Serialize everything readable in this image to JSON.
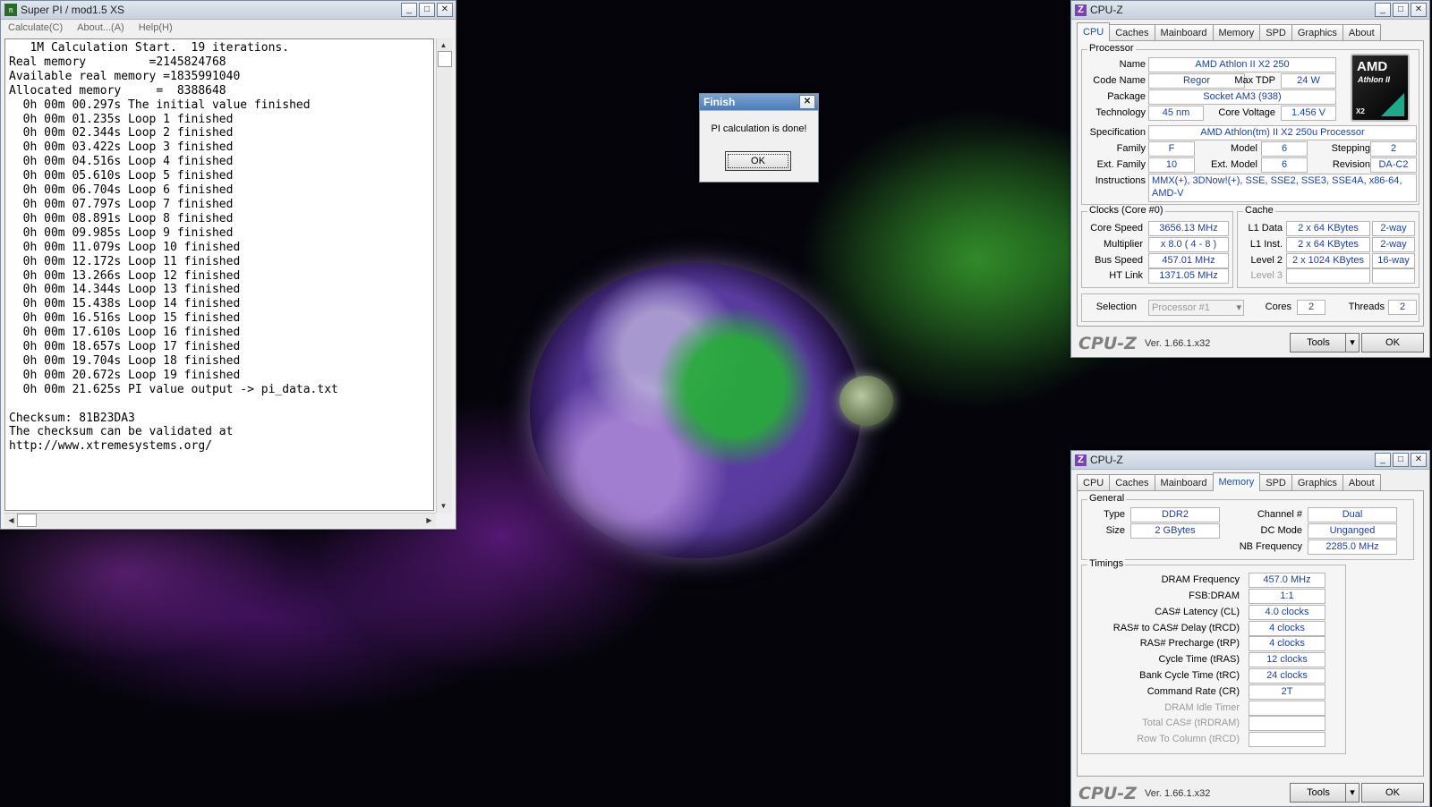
{
  "superpi": {
    "title": "Super PI / mod1.5 XS",
    "menu": [
      "Calculate(C)",
      "About...(A)",
      "Help(H)"
    ],
    "lines": [
      "   1M Calculation Start.  19 iterations.",
      "Real memory         =2145824768",
      "Available real memory =1835991040",
      "Allocated memory     =  8388648",
      "  0h 00m 00.297s The initial value finished",
      "  0h 00m 01.235s Loop 1 finished",
      "  0h 00m 02.344s Loop 2 finished",
      "  0h 00m 03.422s Loop 3 finished",
      "  0h 00m 04.516s Loop 4 finished",
      "  0h 00m 05.610s Loop 5 finished",
      "  0h 00m 06.704s Loop 6 finished",
      "  0h 00m 07.797s Loop 7 finished",
      "  0h 00m 08.891s Loop 8 finished",
      "  0h 00m 09.985s Loop 9 finished",
      "  0h 00m 11.079s Loop 10 finished",
      "  0h 00m 12.172s Loop 11 finished",
      "  0h 00m 13.266s Loop 12 finished",
      "  0h 00m 14.344s Loop 13 finished",
      "  0h 00m 15.438s Loop 14 finished",
      "  0h 00m 16.516s Loop 15 finished",
      "  0h 00m 17.610s Loop 16 finished",
      "  0h 00m 18.657s Loop 17 finished",
      "  0h 00m 19.704s Loop 18 finished",
      "  0h 00m 20.672s Loop 19 finished",
      "  0h 00m 21.625s PI value output -> pi_data.txt",
      "",
      "Checksum: 81B23DA3",
      "The checksum can be validated at",
      "http://www.xtremesystems.org/"
    ]
  },
  "finish_dialog": {
    "title": "Finish",
    "message": "PI calculation is done!",
    "ok": "OK"
  },
  "cpuz_common": {
    "title": "CPU-Z",
    "tabs": [
      "CPU",
      "Caches",
      "Mainboard",
      "Memory",
      "SPD",
      "Graphics",
      "About"
    ],
    "brand": "CPU-Z",
    "version": "Ver. 1.66.1.x32",
    "tools": "Tools",
    "ok": "OK"
  },
  "cpu": {
    "group_processor": "Processor",
    "name_label": "Name",
    "name": "AMD Athlon II X2 250",
    "codename_label": "Code Name",
    "codename": "Regor",
    "maxtdp_label": "Max TDP",
    "maxtdp": "24 W",
    "package_label": "Package",
    "package": "Socket AM3 (938)",
    "tech_label": "Technology",
    "tech": "45 nm",
    "voltage_label": "Core Voltage",
    "voltage": "1.456 V",
    "spec_label": "Specification",
    "spec": "AMD Athlon(tm) II X2 250u Processor",
    "family_label": "Family",
    "family": "F",
    "model_label": "Model",
    "model": "6",
    "stepping_label": "Stepping",
    "stepping": "2",
    "extfamily_label": "Ext. Family",
    "extfamily": "10",
    "extmodel_label": "Ext. Model",
    "extmodel": "6",
    "revision_label": "Revision",
    "revision": "DA-C2",
    "instr_label": "Instructions",
    "instr": "MMX(+), 3DNow!(+), SSE, SSE2, SSE3, SSE4A, x86-64, AMD-V",
    "logo": {
      "brand": "AMD",
      "line": "Athlon II",
      "badge": "X2"
    },
    "group_clocks": "Clocks (Core #0)",
    "corespeed_label": "Core Speed",
    "corespeed": "3656.13 MHz",
    "multiplier_label": "Multiplier",
    "multiplier": "x 8.0 ( 4 - 8 )",
    "busspeed_label": "Bus Speed",
    "busspeed": "457.01 MHz",
    "htlink_label": "HT Link",
    "htlink": "1371.05 MHz",
    "group_cache": "Cache",
    "l1d_label": "L1 Data",
    "l1d": "2 x 64 KBytes",
    "l1d_way": "2-way",
    "l1i_label": "L1 Inst.",
    "l1i": "2 x 64 KBytes",
    "l1i_way": "2-way",
    "l2_label": "Level 2",
    "l2": "2 x 1024 KBytes",
    "l2_way": "16-way",
    "l3_label": "Level 3",
    "selection_label": "Selection",
    "selection": "Processor #1",
    "cores_label": "Cores",
    "cores": "2",
    "threads_label": "Threads",
    "threads": "2"
  },
  "memory": {
    "group_general": "General",
    "type_label": "Type",
    "type": "DDR2",
    "size_label": "Size",
    "size": "2 GBytes",
    "channel_label": "Channel #",
    "channel": "Dual",
    "dcmode_label": "DC Mode",
    "dcmode": "Unganged",
    "nbfreq_label": "NB Frequency",
    "nbfreq": "2285.0 MHz",
    "group_timings": "Timings",
    "dram_freq_label": "DRAM Frequency",
    "dram_freq": "457.0 MHz",
    "fsb_label": "FSB:DRAM",
    "fsb": "1:1",
    "cl_label": "CAS# Latency (CL)",
    "cl": "4.0 clocks",
    "trcd_label": "RAS# to CAS# Delay (tRCD)",
    "trcd": "4 clocks",
    "trp_label": "RAS# Precharge (tRP)",
    "trp": "4 clocks",
    "tras_label": "Cycle Time (tRAS)",
    "tras": "12 clocks",
    "trc_label": "Bank Cycle Time (tRC)",
    "trc": "24 clocks",
    "cr_label": "Command Rate (CR)",
    "cr": "2T",
    "idle_label": "DRAM Idle Timer",
    "trdram_label": "Total CAS# (tRDRAM)",
    "rtc_label": "Row To Column (tRCD)"
  }
}
